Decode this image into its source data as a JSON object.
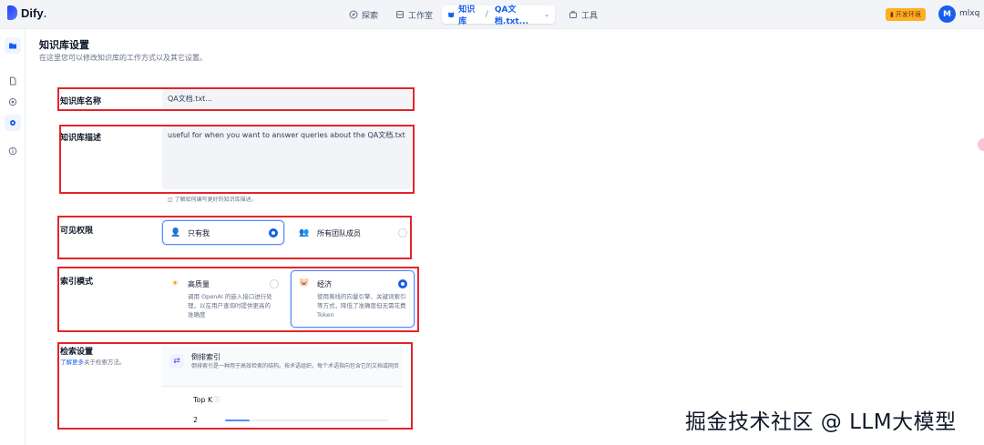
{
  "app": {
    "brand": "Dify",
    "brand_suffix": "."
  },
  "nav": {
    "explore": "探索",
    "studio": "工作室",
    "knowledge": "知识库",
    "current_dataset": "QA文档.txt...",
    "tools": "工具"
  },
  "env_badge": "开发环境",
  "user": {
    "initial": "M",
    "name": "mlxq"
  },
  "page": {
    "title": "知识库设置",
    "subtitle": "在这里您可以修改知识库的工作方式以及其它设置。"
  },
  "name_field": {
    "label": "知识库名称",
    "value": "QA文档.txt..."
  },
  "desc_field": {
    "label": "知识库描述",
    "value": "useful for when you want to answer queries about the QA文档.txt",
    "hint": "了解如何编写更好的知识库描述。"
  },
  "permission": {
    "label": "可见权限",
    "options": [
      {
        "label": "只有我",
        "selected": true
      },
      {
        "label": "所有团队成员",
        "selected": false
      }
    ]
  },
  "index_mode": {
    "label": "索引模式",
    "options": [
      {
        "label": "高质量",
        "desc": "调用 OpenAI 的嵌入接口进行处理，以在用户查询时提供更高的准确度",
        "selected": false
      },
      {
        "label": "经济",
        "desc": "使用离线的向量引擎、关键词索引等方式，降低了准确度但无需花费 Token",
        "selected": true
      }
    ]
  },
  "retrieval": {
    "label": "检索设置",
    "learn_more": "了解更多",
    "learn_more_tail": "关于检索方法。",
    "method_title": "倒排索引",
    "method_desc": "倒排索引是一种用于高效检索的结构。按术语组织，每个术语指向包含它的文档或网页",
    "topk_label": "Top K",
    "topk_value": "2",
    "topk_fraction": 0.15
  },
  "watermark": "掘金技术社区 @ LLM大模型",
  "colors": {
    "accent": "#155eef",
    "highlight_box": "#e5242c",
    "env_badge": "#fdb022"
  }
}
